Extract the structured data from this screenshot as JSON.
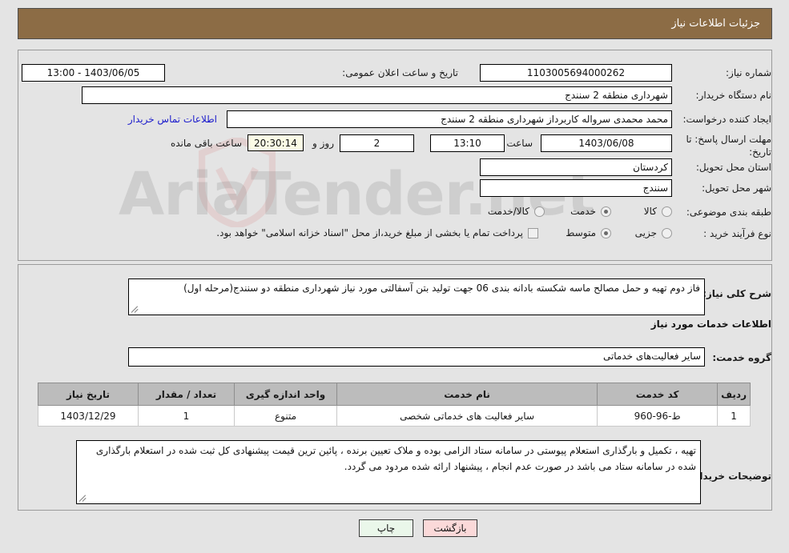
{
  "header": {
    "title": "جزئیات اطلاعات نیاز"
  },
  "watermark": {
    "text": "AriaTender.net",
    "shield_icon": "shield-icon"
  },
  "info": {
    "need_number_label": "شماره نیاز:",
    "need_number_value": "1103005694000262",
    "announce_datetime_label": "تاریخ و ساعت اعلان عمومی:",
    "announce_datetime_value": "1403/06/05 - 13:00",
    "buyer_org_label": "نام دستگاه خریدار:",
    "buyer_org_value": "شهرداری منطقه 2 سنندج",
    "requester_label": "ایجاد کننده درخواست:",
    "requester_value": "محمد محمدی سرواله کاربرداز شهرداری منطقه 2 سنندج",
    "contact_link": "اطلاعات تماس خریدار",
    "deadline_label": "مهلت ارسال پاسخ: تا تاریخ:",
    "deadline_date": "1403/06/08",
    "time_label": "ساعت",
    "deadline_time": "13:10",
    "days_value": "2",
    "days_unit": "روز و",
    "countdown_value": "20:30:14",
    "countdown_unit": "ساعت باقی مانده",
    "province_label": "استان محل تحویل:",
    "province_value": "کردستان",
    "city_label": "شهر محل تحویل:",
    "city_value": "سنندج",
    "category_label": "طبقه بندی موضوعی:",
    "category_options": [
      {
        "label": "کالا",
        "selected": false
      },
      {
        "label": "خدمت",
        "selected": true
      },
      {
        "label": "کالا/خدمت",
        "selected": false
      }
    ],
    "process_label": "نوع فرآیند خرید :",
    "process_options": [
      {
        "label": "جزیی",
        "selected": false
      },
      {
        "label": "متوسط",
        "selected": true
      }
    ],
    "treasury_checkbox_label": "پرداخت تمام یا بخشی از مبلغ خرید،از محل \"اسناد خزانه اسلامی\" خواهد بود.",
    "treasury_checked": false
  },
  "description": {
    "label": "شرح کلی نیاز:",
    "value": "فاز دوم تهیه و حمل مصالح ماسه شکسته بادانه بندی 06 جهت تولید بتن آسفالتی مورد نیاز شهرداری منطقه دو سنندج(مرحله اول)"
  },
  "services": {
    "section_title": "اطلاعات خدمات مورد نیاز",
    "group_label": "گروه خدمت:",
    "group_value": "سایر فعالیت‌های خدماتی",
    "columns": [
      "ردیف",
      "کد خدمت",
      "نام خدمت",
      "واحد اندازه گیری",
      "تعداد / مقدار",
      "تاریخ نیاز"
    ],
    "rows": [
      {
        "row": "1",
        "code": "ط-96-960",
        "name": "سایر فعالیت های خدماتی شخصی",
        "unit": "متنوع",
        "qty": "1",
        "need_date": "1403/12/29"
      }
    ]
  },
  "notes": {
    "label": "توضیحات خریدار:",
    "value": "تهیه ، تکمیل و بارگذاری استعلام پیوستی در سامانه ستاد الزامی بوده و ملاک تعیین برنده ، پائین ترین قیمت پیشنهادی کل ثبت شده در استعلام بارگذاری شده در سامانه ستاد می باشد در صورت عدم انجام ، پیشنهاد ارائه شده مردود می گردد."
  },
  "footer": {
    "print_label": "چاپ",
    "back_label": "بازگشت"
  },
  "colors": {
    "header_bar": "#8c6c45",
    "page_bg": "#e4e4e4",
    "table_header": "#bcbcbc",
    "link": "#1b1bcc",
    "print_btn": "#eaf7ea",
    "back_btn": "#fbd9d9",
    "countdown_bg": "#fbfbe6"
  }
}
